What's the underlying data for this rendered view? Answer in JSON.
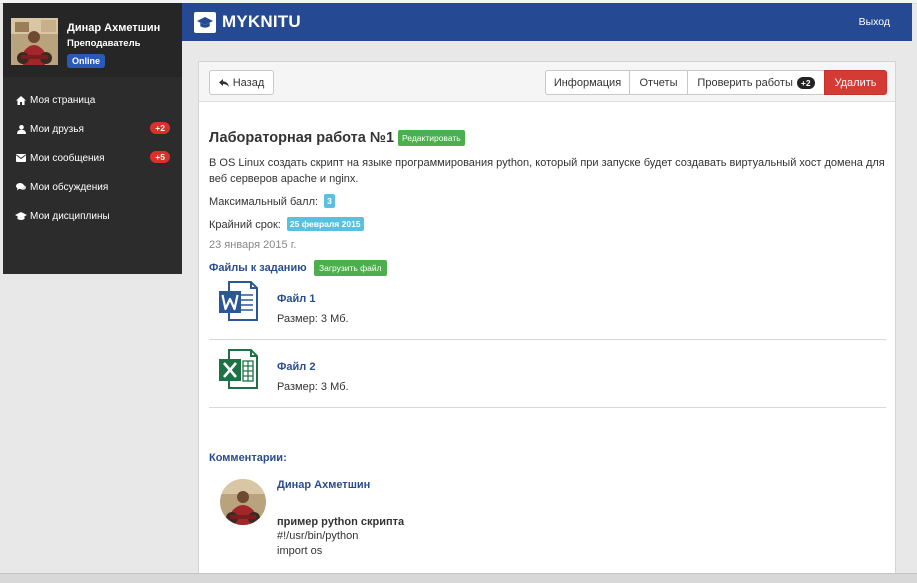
{
  "sidebar": {
    "profile": {
      "name": "Динар Ахметшин",
      "role": "Преподаватель",
      "status": "Online"
    },
    "items": [
      {
        "label": "Моя страница",
        "icon": "home-icon"
      },
      {
        "label": "Мои друзья",
        "icon": "user-icon",
        "badge": "+2"
      },
      {
        "label": "Мои сообщения",
        "icon": "envelope-icon",
        "badge": "+5"
      },
      {
        "label": "Мои обсуждения",
        "icon": "comments-icon"
      },
      {
        "label": "Мои дисциплины",
        "icon": "graduation-cap-icon"
      }
    ]
  },
  "header": {
    "logo": "MYKNITU",
    "logout": "Выход"
  },
  "toolbar": {
    "back": "Назад",
    "info": "Информация",
    "reports": "Отчеты",
    "check": "Проверить работы",
    "check_badge": "+2",
    "delete": "Удалить"
  },
  "task": {
    "title": "Лабораторная работа №1",
    "edit": "Редактировать",
    "description": "В OS Linux создать скрипт на языке программирования python, который при запуске будет создавать виртуальный хост домена для веб серверов apache и nginx.",
    "max_score_label": "Максимальный балл:",
    "max_score": "3",
    "deadline_label": "Крайний срок:",
    "deadline": "25 февраля 2015",
    "date": "23 января 2015 г."
  },
  "files": {
    "title": "Файлы к заданию",
    "upload": "Загрузить файл",
    "items": [
      {
        "name": "Файл 1",
        "size": "Размер: 3 Мб.",
        "icon": "word-file-icon"
      },
      {
        "name": "Файл 2",
        "size": "Размер: 3 Мб.",
        "icon": "excel-file-icon"
      }
    ]
  },
  "comments": {
    "title": "Комментарии:",
    "items": [
      {
        "author": "Динар Ахметшин",
        "title": "пример python скрипта",
        "lines": [
          "#!/usr/bin/python",
          "import os"
        ]
      }
    ]
  },
  "colors": {
    "header": "#254a93",
    "sidebar": "#2c2c2c",
    "badge_red": "#d9302c",
    "online": "#2a5ab8",
    "delete": "#d43b35",
    "success": "#4cae4c",
    "info": "#5bc0de",
    "link": "#2a4d8f"
  }
}
